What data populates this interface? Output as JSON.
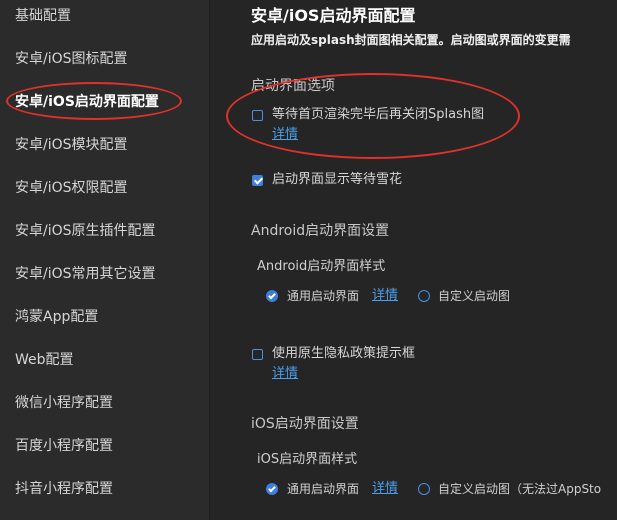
{
  "colors": {
    "sidebar_bg": "#2b2b2b",
    "main_bg": "#252526",
    "accent": "#3d7fd9",
    "link": "#4a9fe8",
    "annotation": "#e0312b"
  },
  "sidebar": {
    "items": [
      {
        "label": "基础配置"
      },
      {
        "label": "安卓/iOS图标配置"
      },
      {
        "label": "安卓/iOS启动界面配置",
        "active": true
      },
      {
        "label": "安卓/iOS模块配置"
      },
      {
        "label": "安卓/iOS权限配置"
      },
      {
        "label": "安卓/iOS原生插件配置"
      },
      {
        "label": "安卓/iOS常用其它设置"
      },
      {
        "label": "鸿蒙App配置"
      },
      {
        "label": "Web配置"
      },
      {
        "label": "微信小程序配置"
      },
      {
        "label": "百度小程序配置"
      },
      {
        "label": "抖音小程序配置"
      }
    ]
  },
  "main": {
    "title": "安卓/iOS启动界面配置",
    "description": "应用启动及splash封面图相关配置。启动图或界面的变更需",
    "splash_section": {
      "title": "启动界面选项",
      "close_after_render": {
        "label": "等待首页渲染完毕后再关闭Splash图",
        "checked": false,
        "detail_link": "详情"
      },
      "show_waiting_snow": {
        "label": "启动界面显示等待雪花",
        "checked": true
      }
    },
    "android_section": {
      "title": "Android启动界面设置",
      "style_title": "Android启动界面样式",
      "options": {
        "default": {
          "label": "通用启动界面",
          "checked": true,
          "detail_link": "详情"
        },
        "custom": {
          "label": "自定义启动图",
          "checked": false
        }
      },
      "privacy": {
        "label": "使用原生隐私政策提示框",
        "checked": false,
        "detail_link": "详情"
      }
    },
    "ios_section": {
      "title": "iOS启动界面设置",
      "style_title": "iOS启动界面样式",
      "options": {
        "default": {
          "label": "通用启动界面",
          "checked": true,
          "detail_link": "详情"
        },
        "custom": {
          "label": "自定义启动图（无法过AppSto",
          "checked": false
        }
      }
    }
  }
}
